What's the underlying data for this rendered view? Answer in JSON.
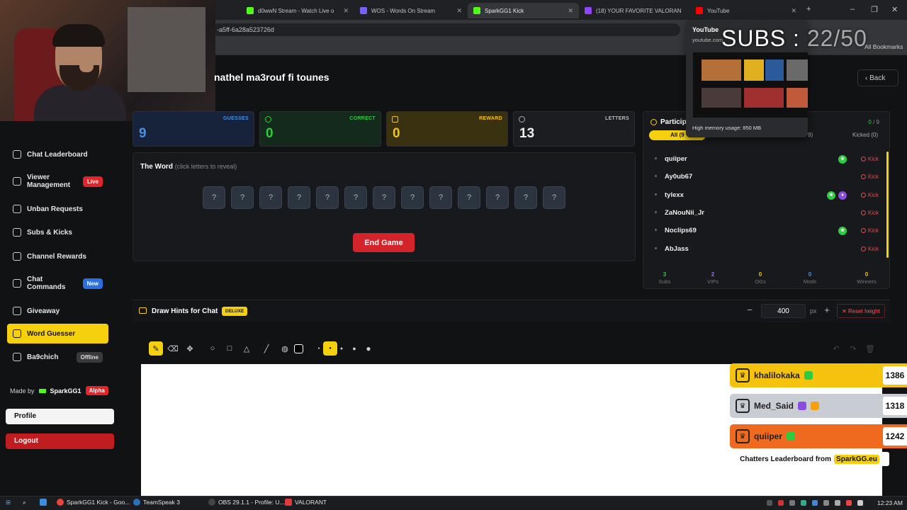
{
  "browser": {
    "tabs": [
      {
        "label": "d0wwN Stream - Watch Live o",
        "color": "#53fc18"
      },
      {
        "label": "WOS - Words On Stream",
        "color": "#7a5cff"
      },
      {
        "label": "SparkGG1 Kick",
        "color": "#53fc18"
      },
      {
        "label": "(18) YOUR FAVORITE VALORAN",
        "color": "#9146ff"
      },
      {
        "label": "YouTube",
        "color": "#ff0000"
      }
    ],
    "address": "-a5ff-6a28a523726d",
    "bookmarks_label": "All Bookmarks"
  },
  "youtube_card": {
    "title": "YouTube",
    "url": "youtube.com",
    "memory": "High memory usage: 850 MB"
  },
  "subs_overlay": {
    "label": "SUBS :",
    "value": "22/50"
  },
  "sidebar": {
    "items": [
      {
        "label": "Chat Leaderboard"
      },
      {
        "label": "Viewer Management",
        "badge": "Live"
      },
      {
        "label": "Unban Requests"
      },
      {
        "label": "Subs & Kicks"
      },
      {
        "label": "Channel Rewards"
      },
      {
        "label": "Chat Commands",
        "badge": "New"
      },
      {
        "label": "Giveaway"
      },
      {
        "label": "Word Guesser"
      },
      {
        "label": "Ba9chich",
        "badge": "Offline"
      }
    ],
    "made_by": "Made by",
    "brand": "SparkGG1",
    "brand_badge": "Alpha",
    "profile": "Profile",
    "logout": "Logout"
  },
  "main": {
    "title": "nathel ma3rouf fi tounes",
    "back": "Back",
    "stats": [
      {
        "label": "GUESSES",
        "value": "9",
        "color": "#4a8fe0"
      },
      {
        "label": "CORRECT",
        "value": "0",
        "color": "#2ecc40"
      },
      {
        "label": "REWARD",
        "value": "0",
        "color": "#f5c20d"
      },
      {
        "label": "LETTERS",
        "value": "13",
        "color": "#d0d0d0"
      }
    ],
    "word_title": "The Word",
    "word_hint": "(click letters to reveal)",
    "letters": [
      "?",
      "?",
      "?",
      "?",
      "?",
      "?",
      "?",
      "?",
      "?",
      "?",
      "?",
      "?",
      "?"
    ],
    "end_game": "End Game"
  },
  "participants": {
    "title": "Particip",
    "count_active": "0",
    "count_sep": "/",
    "count_total": "9",
    "tab_all": "All (9",
    "tab_subs": "9)",
    "tab_kicked": "Kicked (0)",
    "rows": [
      {
        "name": "quiiper",
        "badges": [
          "green"
        ]
      },
      {
        "name": "Ay0ub67",
        "badges": []
      },
      {
        "name": "tylexx",
        "badges": [
          "green",
          "purple"
        ]
      },
      {
        "name": "ZaNouNii_Jr",
        "badges": []
      },
      {
        "name": "Noclips69",
        "badges": [
          "green"
        ]
      },
      {
        "name": "AbJass",
        "badges": []
      }
    ],
    "kick_label": "Kick",
    "summary": [
      {
        "value": "3",
        "label": "Subs",
        "color": "#2ecc40"
      },
      {
        "value": "2",
        "label": "VIPs",
        "color": "#9b6dff"
      },
      {
        "value": "0",
        "label": "OGs",
        "color": "#f5c20d"
      },
      {
        "value": "0",
        "label": "Mods",
        "color": "#4a8fe0"
      },
      {
        "value": "0",
        "label": "Winners",
        "color": "#f5c20d"
      }
    ]
  },
  "hints": {
    "title": "Draw Hints for Chat",
    "badge": "DELUXE",
    "height_value": "400",
    "unit": "px",
    "reset": "Reset height"
  },
  "leaderboard": {
    "rows": [
      {
        "name": "khalilokaka",
        "score": "1386",
        "color": "#f5c20d"
      },
      {
        "name": "Med_Said",
        "score": "1318",
        "color": "#c8cdd4"
      },
      {
        "name": "quiiper",
        "score": "1242",
        "color": "#ef6a1f"
      }
    ],
    "footer": "Chatters Leaderboard from",
    "brand": "SparkGG.eu"
  },
  "taskbar": {
    "items": [
      "SparkGG1 Kick - Goo...",
      "TeamSpeak 3",
      "OBS 29.1.1 - Profile: U...",
      "VALORANT"
    ],
    "clock": "12:23 AM"
  }
}
